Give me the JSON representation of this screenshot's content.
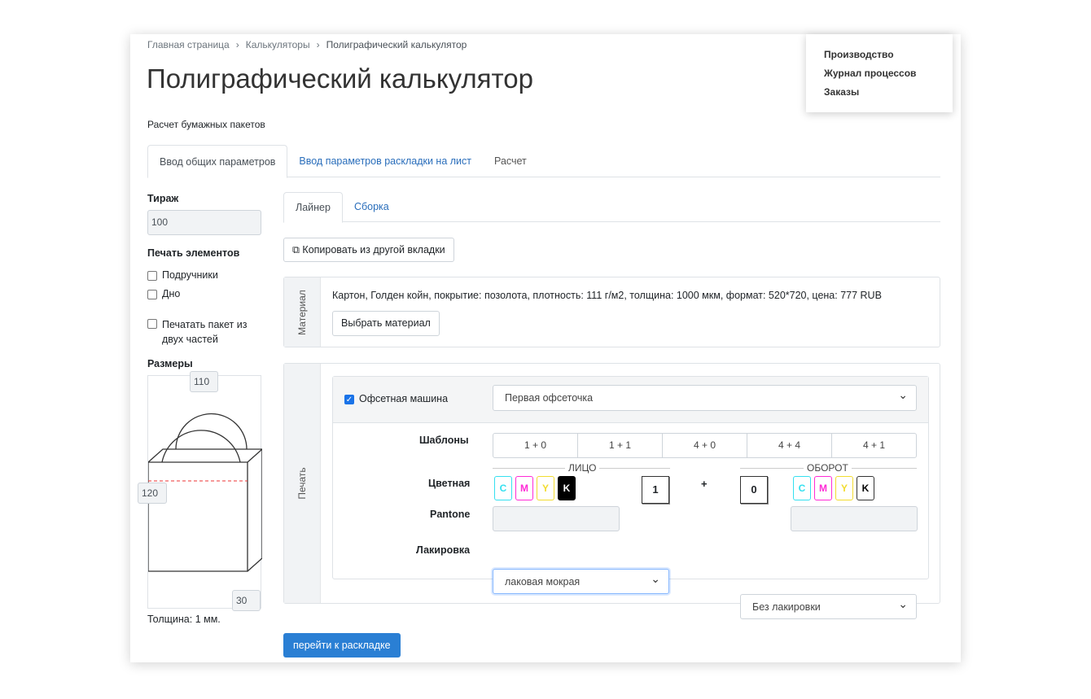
{
  "breadcrumb": [
    "Главная страница",
    "Калькуляторы",
    "Полиграфический калькулятор"
  ],
  "title": "Полиграфический калькулятор",
  "subtitle": "Расчет бумажных пакетов",
  "tabs": [
    "Ввод общих параметров",
    "Ввод параметров раскладки на лист",
    "Расчет"
  ],
  "menu": [
    "Производство",
    "Журнал процессов",
    "Заказы"
  ],
  "left": {
    "tirazh_label": "Тираж",
    "tirazh_value": "100",
    "print_label": "Печать элементов",
    "checks": [
      "Подручники",
      "Дно",
      "Печатать пакет из двух частей"
    ],
    "sizes_label": "Размеры",
    "width": "110",
    "height": "120",
    "depth": "30",
    "thickness": "Толщина: 1 мм."
  },
  "subtabs": [
    "Лайнер",
    "Сборка"
  ],
  "copy_button": "Копировать из другой вкладки",
  "material": {
    "label": "Материал",
    "text": "Картон, Голден койн, покрытие: позолота, плотность: 111 г/м2, толщина: 1000 мкм, формат: 520*720, цена: 777 RUB",
    "button": "Выбрать материал"
  },
  "print": {
    "label": "Печать",
    "machine_label": "Офсетная машина",
    "machine_value": "Первая офсеточка",
    "templates_label": "Шаблоны",
    "templates": [
      "1 + 0",
      "1 + 1",
      "4 + 0",
      "4 + 4",
      "4 + 1"
    ],
    "face": "ЛИЦО",
    "back": "ОБОРОТ",
    "color_label": "Цветная",
    "inks": [
      "C",
      "M",
      "Y",
      "K"
    ],
    "face_count": "1",
    "plus": "+",
    "back_count": "0",
    "pantone_label": "Pantone",
    "lacquer_label": "Лакировка",
    "lacquer_face": "лаковая мокрая",
    "lacquer_back": "Без лакировки"
  },
  "next_button": "перейти к раскладке",
  "colors": {
    "cyan": "#35e0f0",
    "magenta": "#ff2bd6",
    "yellow": "#f2dc30",
    "primary": "#2a7fd4"
  }
}
